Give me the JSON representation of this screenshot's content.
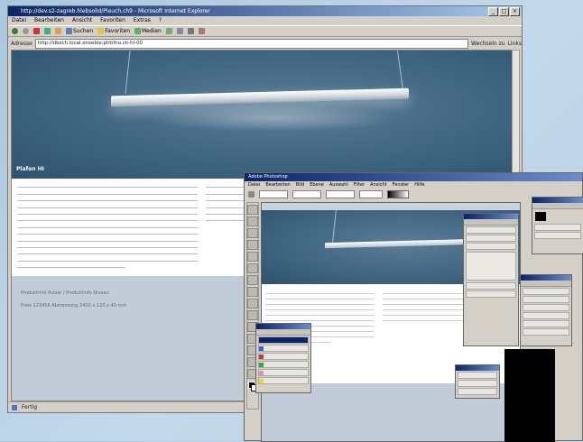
{
  "browser": {
    "title": "http://dev.s2-zagreb.hlebsolid/Pleuch.ch9 - Microsoft Internet Explorer",
    "menu": [
      "Datei",
      "Bearbeiten",
      "Ansicht",
      "Favoriten",
      "Extras",
      "?"
    ],
    "toolbar": [
      "Suchen",
      "Favoriten",
      "Medien"
    ],
    "address_label": "Adresse",
    "address_value": "http://dbsch.local.enseble.ptd/iho.ch-hl-00",
    "go_label": "Wechseln zu",
    "links_label": "Links",
    "status": "Fertig"
  },
  "page": {
    "caption": "Plafon HI",
    "gray_title": "Produktinfo Pulsar / Produktinfo Niveau",
    "gray_line": "Preis 123456    Abmessung    2400 x 120 x 40 mm"
  },
  "photoshop": {
    "title": "Adobe Photoshop",
    "menu": [
      "Datei",
      "Bearbeiten",
      "Bild",
      "Ebene",
      "Auswahl",
      "Filter",
      "Ansicht",
      "Fenster",
      "Hilfe"
    ]
  },
  "colors": {
    "accent": "#0a246a",
    "hero": "#3f6581",
    "panel_gray": "#c2ccd8"
  }
}
